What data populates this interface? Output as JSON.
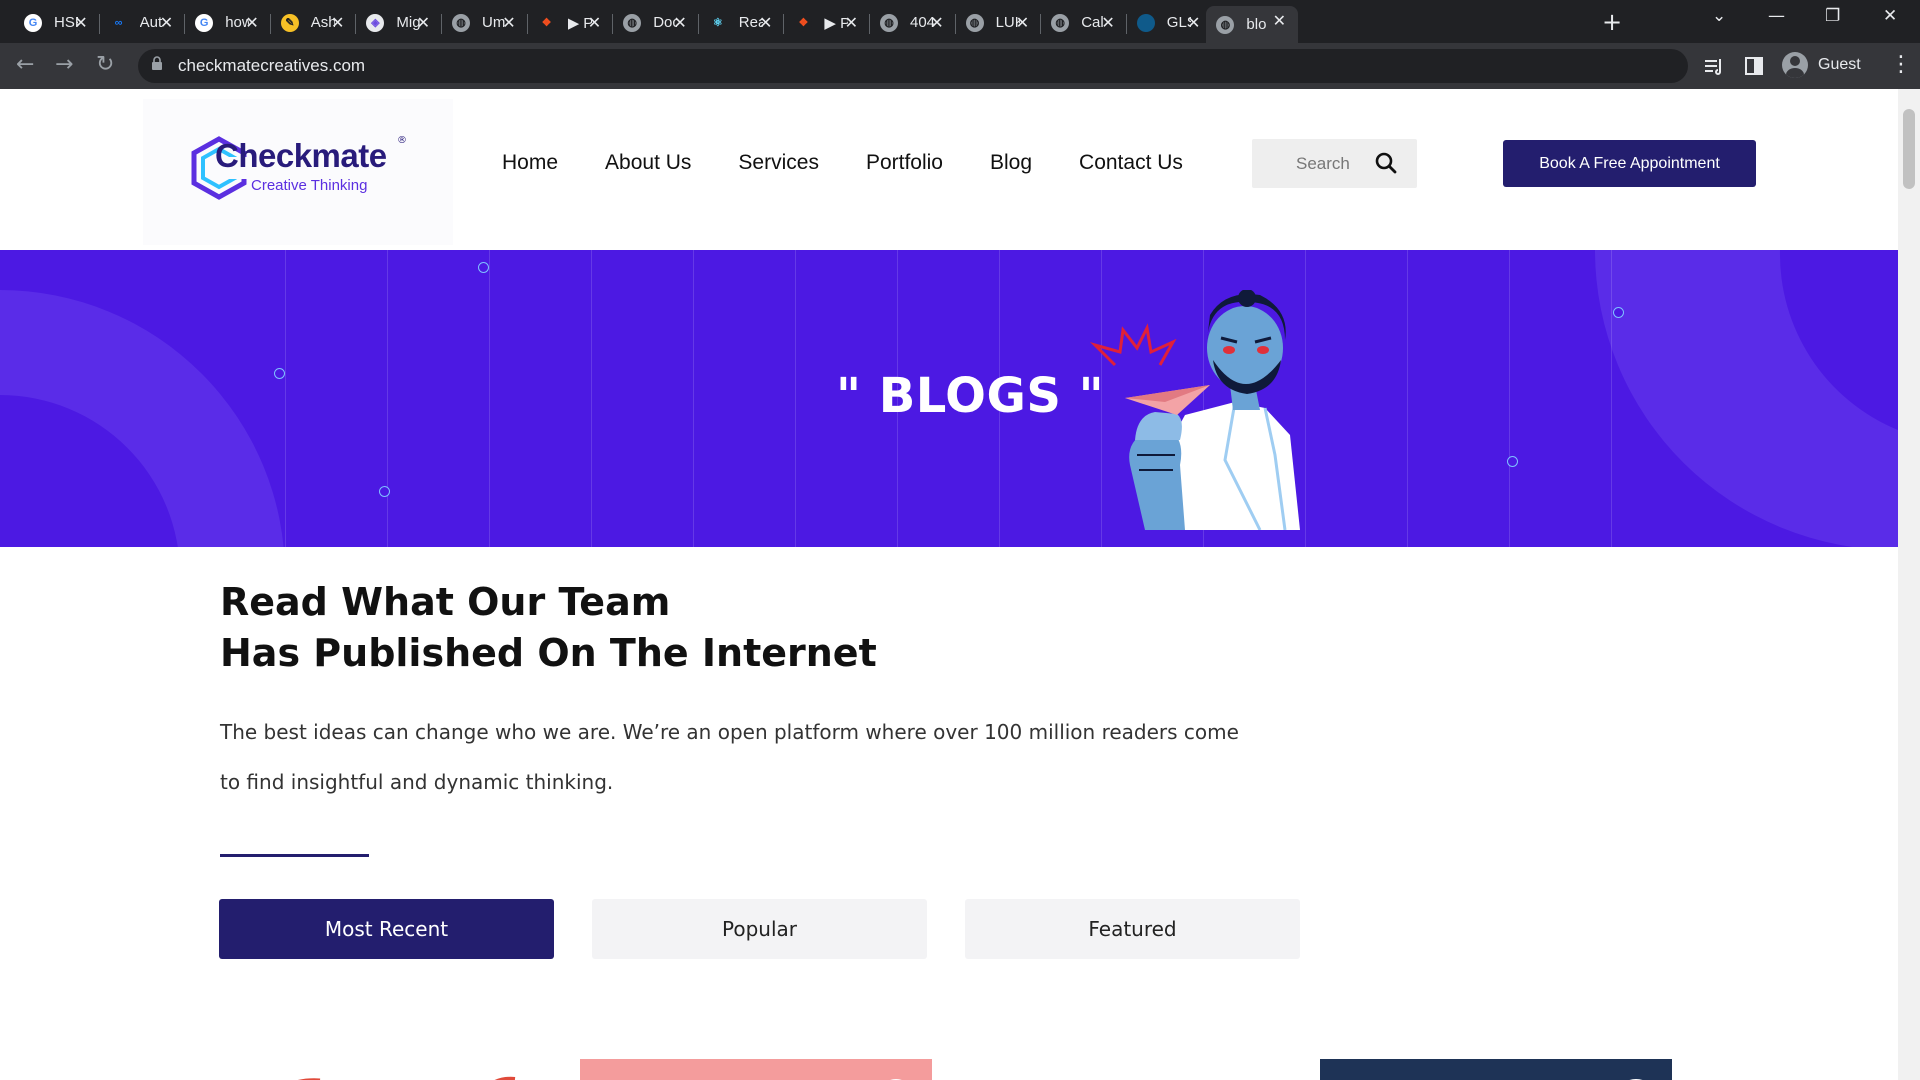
{
  "browser": {
    "tabs": [
      {
        "label": "HSF",
        "icon": "google-icon"
      },
      {
        "label": "Aut",
        "icon": "meta-icon"
      },
      {
        "label": "how",
        "icon": "google-icon"
      },
      {
        "label": "Ash",
        "icon": "blog-icon"
      },
      {
        "label": "Mig",
        "icon": "app-icon"
      },
      {
        "label": "Um",
        "icon": "globe-icon"
      },
      {
        "label": "▶ P",
        "icon": "figma-icon"
      },
      {
        "label": "Doc",
        "icon": "globe-icon"
      },
      {
        "label": "Rea",
        "icon": "react-icon"
      },
      {
        "label": "▶ P",
        "icon": "figma-icon"
      },
      {
        "label": "404",
        "icon": "globe-icon"
      },
      {
        "label": "LUK",
        "icon": "globe-icon"
      },
      {
        "label": "Cal",
        "icon": "globe-icon"
      },
      {
        "label": "GLS",
        "icon": "circle-icon"
      },
      {
        "label": "blo",
        "icon": "globe-icon",
        "active": true
      }
    ],
    "url": "checkmatecreatives.com",
    "profile_label": "Guest"
  },
  "header": {
    "logo_title": "Checkmate",
    "logo_subtitle": "Creative Thinking",
    "logo_mark": "®",
    "nav": [
      "Home",
      "About Us",
      "Services",
      "Portfolio",
      "Blog",
      "Contact Us"
    ],
    "search_placeholder": "Search",
    "cta_label": "Book A Free Appointment"
  },
  "hero": {
    "title": "\" BLOGS \"",
    "accent_color": "#4c19e3"
  },
  "content": {
    "heading_line1": "Read What Our Team",
    "heading_line2": "Has Published On The Internet",
    "intro": "The best ideas can change who we are. We’re an open platform where over 100 million readers come to find insightful and dynamic thinking.",
    "filters": [
      "Most Recent",
      "Popular",
      "Featured"
    ],
    "active_filter": "Most Recent",
    "brand_color": "#231e6e"
  }
}
